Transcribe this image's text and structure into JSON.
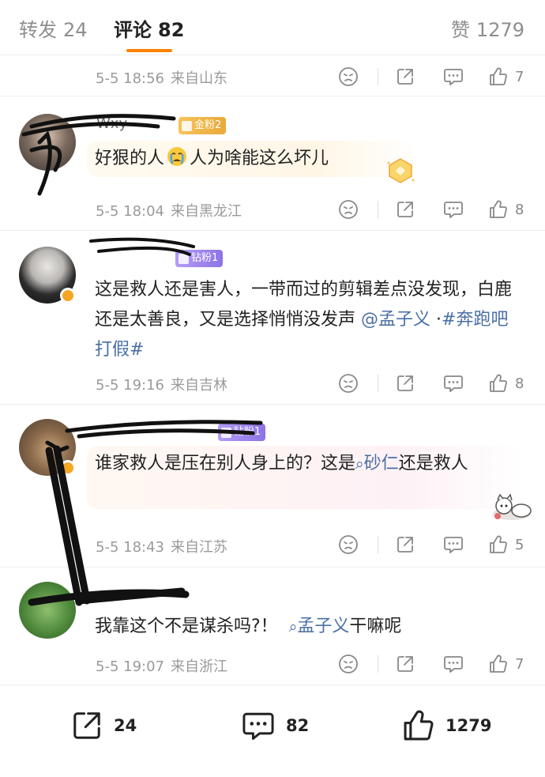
{
  "tabs": {
    "repost": {
      "label": "转发",
      "count": "24"
    },
    "comment": {
      "label": "评论",
      "count": "82"
    },
    "like": {
      "label": "赞",
      "count": "1279"
    }
  },
  "comments": [
    {
      "meta": {
        "time": "5-5 18:56",
        "location": "来自山东"
      },
      "likes": "7"
    },
    {
      "username": "Wxy",
      "fan_badge": "金粉2",
      "content": {
        "before": "好狠的人",
        "emoji": "crying-face",
        "after": "人为啥能这么坏儿"
      },
      "meta": {
        "time": "5-5 18:04",
        "location": "来自黑龙江"
      },
      "likes": "8"
    },
    {
      "username": "",
      "fan_badge": "钻粉1",
      "content": {
        "text": "这是救人还是害人，一带而过的剪辑差点没发现，白鹿还是太善良，又是选择悄悄没发声",
        "mention": "@孟子义",
        "separator": " ·",
        "topic": "#奔跑吧打假#"
      },
      "meta": {
        "time": "5-5 19:16",
        "location": "来自吉林"
      },
      "likes": "8"
    },
    {
      "username": "",
      "fan_badge": "钻粉1",
      "content": {
        "before": "谁家救人是压在别人身上的？这是",
        "search_term": "砂仁",
        "after": "还是救人"
      },
      "meta": {
        "time": "5-5 18:43",
        "location": "来自江苏"
      },
      "likes": "5"
    },
    {
      "username": "",
      "content": {
        "before": "我靠这个不是谋杀吗?！",
        "search_term": "孟子义",
        "after": "干嘛呢"
      },
      "meta": {
        "time": "5-5 19:07",
        "location": "来自浙江"
      },
      "likes": "7"
    }
  ],
  "bottombar": {
    "share_count": "24",
    "comment_count": "82",
    "like_count": "1279"
  },
  "colors": {
    "accent": "#ff8200",
    "link": "#4a6fa5",
    "gold_badge": "#eaa93a",
    "diamond_badge": "#8e73e6"
  },
  "icons": [
    "dislike-icon",
    "share-icon",
    "reply-icon",
    "like-icon",
    "search-icon"
  ]
}
